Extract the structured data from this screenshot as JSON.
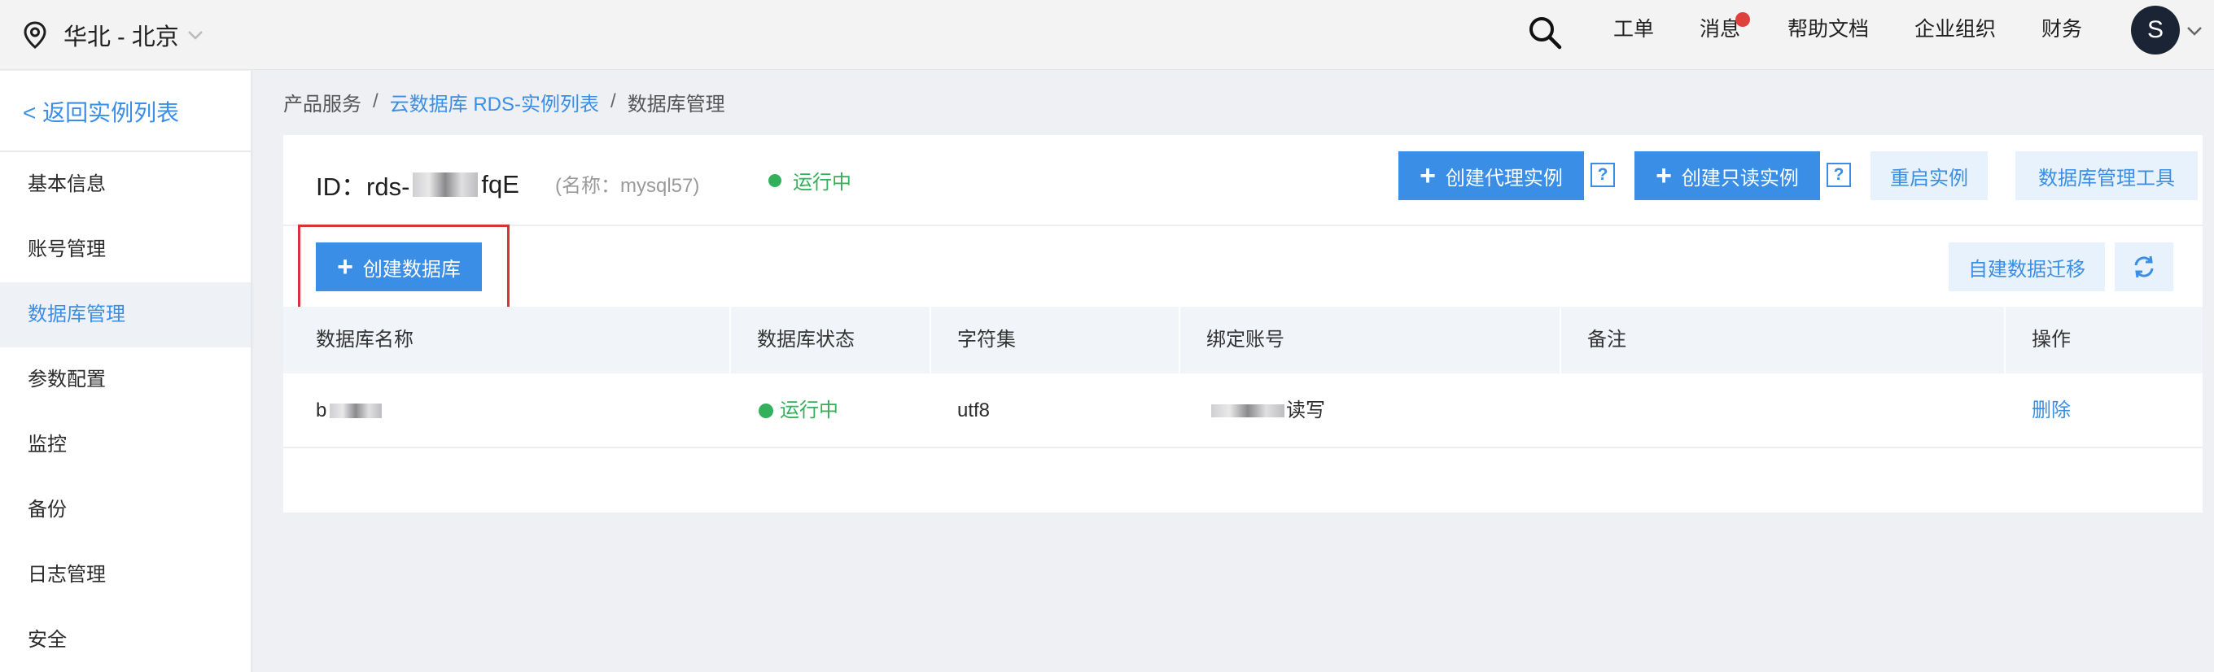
{
  "topbar": {
    "region": "华北 - 北京",
    "links": [
      "工单",
      "消息",
      "帮助文档",
      "企业组织",
      "财务"
    ],
    "avatar_letter": "S"
  },
  "sidebar": {
    "back_label": "< 返回实例列表",
    "items": [
      {
        "label": "基本信息"
      },
      {
        "label": "账号管理"
      },
      {
        "label": "数据库管理",
        "active": true
      },
      {
        "label": "参数配置"
      },
      {
        "label": "监控"
      },
      {
        "label": "备份"
      },
      {
        "label": "日志管理"
      },
      {
        "label": "安全"
      }
    ]
  },
  "breadcrumb": {
    "items": [
      "产品服务",
      "云数据库 RDS-实例列表",
      "数据库管理"
    ]
  },
  "instance": {
    "id_prefix": "ID：rds-",
    "id_suffix": "fqE",
    "name": "(名称：mysql57)",
    "status": "运行中"
  },
  "actions": {
    "create_proxy": "创建代理实例",
    "create_readonly": "创建只读实例",
    "help_glyph": "?",
    "restart": "重启实例",
    "db_tool": "数据库管理工具",
    "create_db": "创建数据库",
    "migrate": "自建数据迁移"
  },
  "table": {
    "columns": [
      "数据库名称",
      "数据库状态",
      "字符集",
      "绑定账号",
      "备注",
      "操作"
    ],
    "rows": [
      {
        "name": "b",
        "status": "运行中",
        "charset": "utf8",
        "account": "读写",
        "remark": "",
        "action": "删除"
      }
    ]
  },
  "colors": {
    "accent": "#3a8ee6",
    "success": "#33b05c",
    "highlight_border": "#d9333a",
    "badge": "#e0403c"
  }
}
